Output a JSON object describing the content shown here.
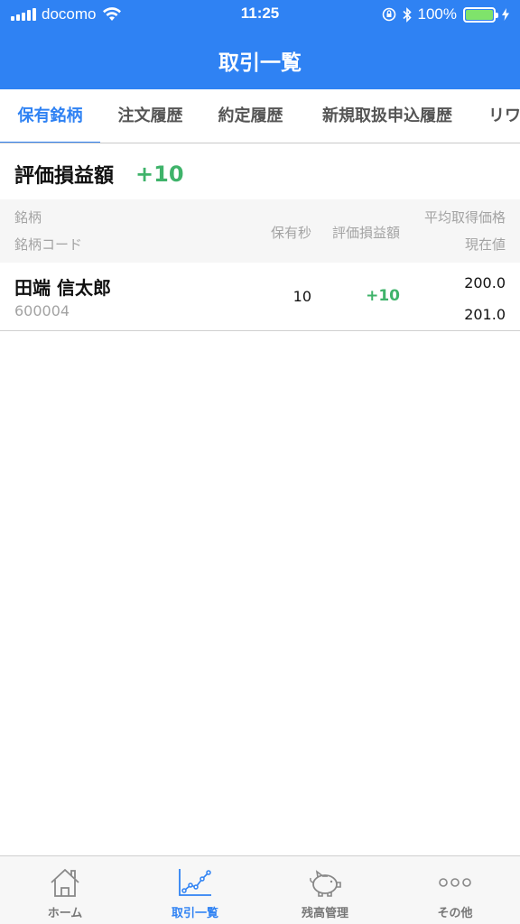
{
  "status_bar": {
    "carrier": "docomo",
    "time": "11:25",
    "battery_text": "100%",
    "battery_level": 1.0
  },
  "header": {
    "title": "取引一覧"
  },
  "tabs": [
    {
      "label": "保有銘柄",
      "active": true
    },
    {
      "label": "注文履歴",
      "active": false
    },
    {
      "label": "約定履歴",
      "active": false
    },
    {
      "label": "新規取扱申込履歴",
      "active": false
    },
    {
      "label": "リワ",
      "active": false
    }
  ],
  "summary": {
    "label": "評価損益額",
    "value": "+10"
  },
  "table": {
    "headers": {
      "name": "銘柄",
      "code": "銘柄コード",
      "seconds": "保有秒",
      "pl": "評価損益額",
      "avg_price": "平均取得価格",
      "current_price": "現在値"
    },
    "rows": [
      {
        "name": "田端 信太郎",
        "code": "600004",
        "seconds": "10",
        "pl": "+10",
        "avg_price": "200.0",
        "current_price": "201.0"
      }
    ]
  },
  "tabbar": {
    "items": [
      {
        "label": "ホーム",
        "icon": "home-icon",
        "active": false
      },
      {
        "label": "取引一覧",
        "icon": "chart-icon",
        "active": true
      },
      {
        "label": "残高管理",
        "icon": "piggy-bank-icon",
        "active": false
      },
      {
        "label": "その他",
        "icon": "more-icon",
        "active": false
      }
    ]
  },
  "colors": {
    "accent": "#2f82f3",
    "positive": "#3fb36a",
    "battery": "#7fe36b"
  }
}
